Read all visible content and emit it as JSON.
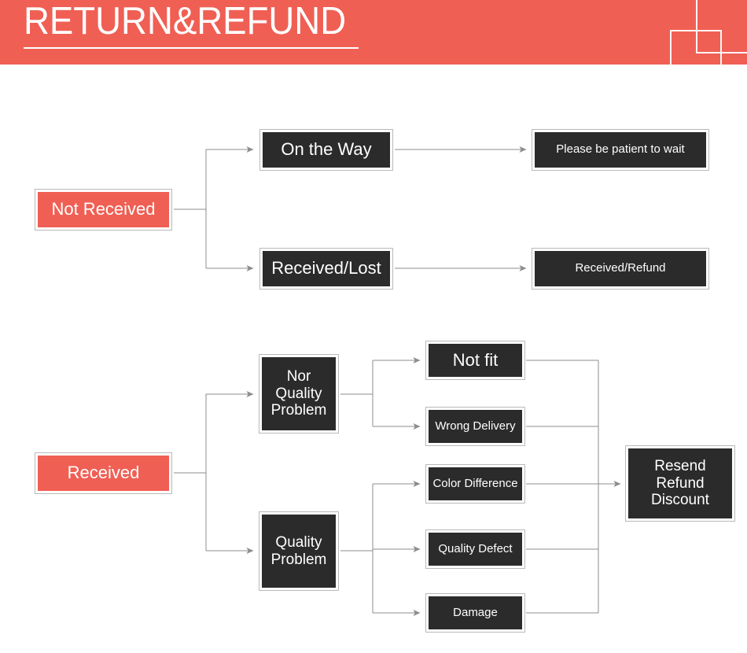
{
  "header": {
    "title": "RETURN&REFUND",
    "background_color": "#f05f54",
    "text_color": "#ffffff",
    "decorations": [
      "square-outline-large",
      "square-outline-small"
    ]
  },
  "colors": {
    "accent_red": "#f05f54",
    "node_dark": "#2b2b2b",
    "node_border": "#b9b9b9",
    "connector": "#8c8c8c",
    "page_background": "#ffffff"
  },
  "diagram": {
    "type": "flowchart",
    "branches": [
      {
        "id": "not-received",
        "root": "Not Received",
        "steps": [
          {
            "stage": "On the Way",
            "result": "Please be patient to wait"
          },
          {
            "stage": "Received/Lost",
            "result": "Received/Refund"
          }
        ]
      },
      {
        "id": "received",
        "root": "Received",
        "categories": [
          {
            "label": "Nor Quality Problem",
            "reasons": [
              "Not fit",
              "Wrong Delivery"
            ]
          },
          {
            "label": "Quality Problem",
            "reasons": [
              "Color Difference",
              "Quality Defect",
              "Damage"
            ]
          }
        ],
        "outcome": "Resend Refund Discount"
      }
    ],
    "nodes": {
      "not_received": "Not Received",
      "on_the_way": "On the Way",
      "please_wait": "Please be patient to wait",
      "received_lost": "Received/Lost",
      "received_refund": "Received/Refund",
      "received": "Received",
      "nor_quality_problem_l1": "Nor",
      "nor_quality_problem_l2": "Quality",
      "nor_quality_problem_l3": "Problem",
      "quality_problem_l1": "Quality",
      "quality_problem_l2": "Problem",
      "not_fit": "Not fit",
      "wrong_delivery": "Wrong Delivery",
      "color_difference": "Color Difference",
      "quality_defect": "Quality Defect",
      "damage": "Damage",
      "resend_l1": "Resend",
      "resend_l2": "Refund",
      "resend_l3": "Discount"
    }
  }
}
